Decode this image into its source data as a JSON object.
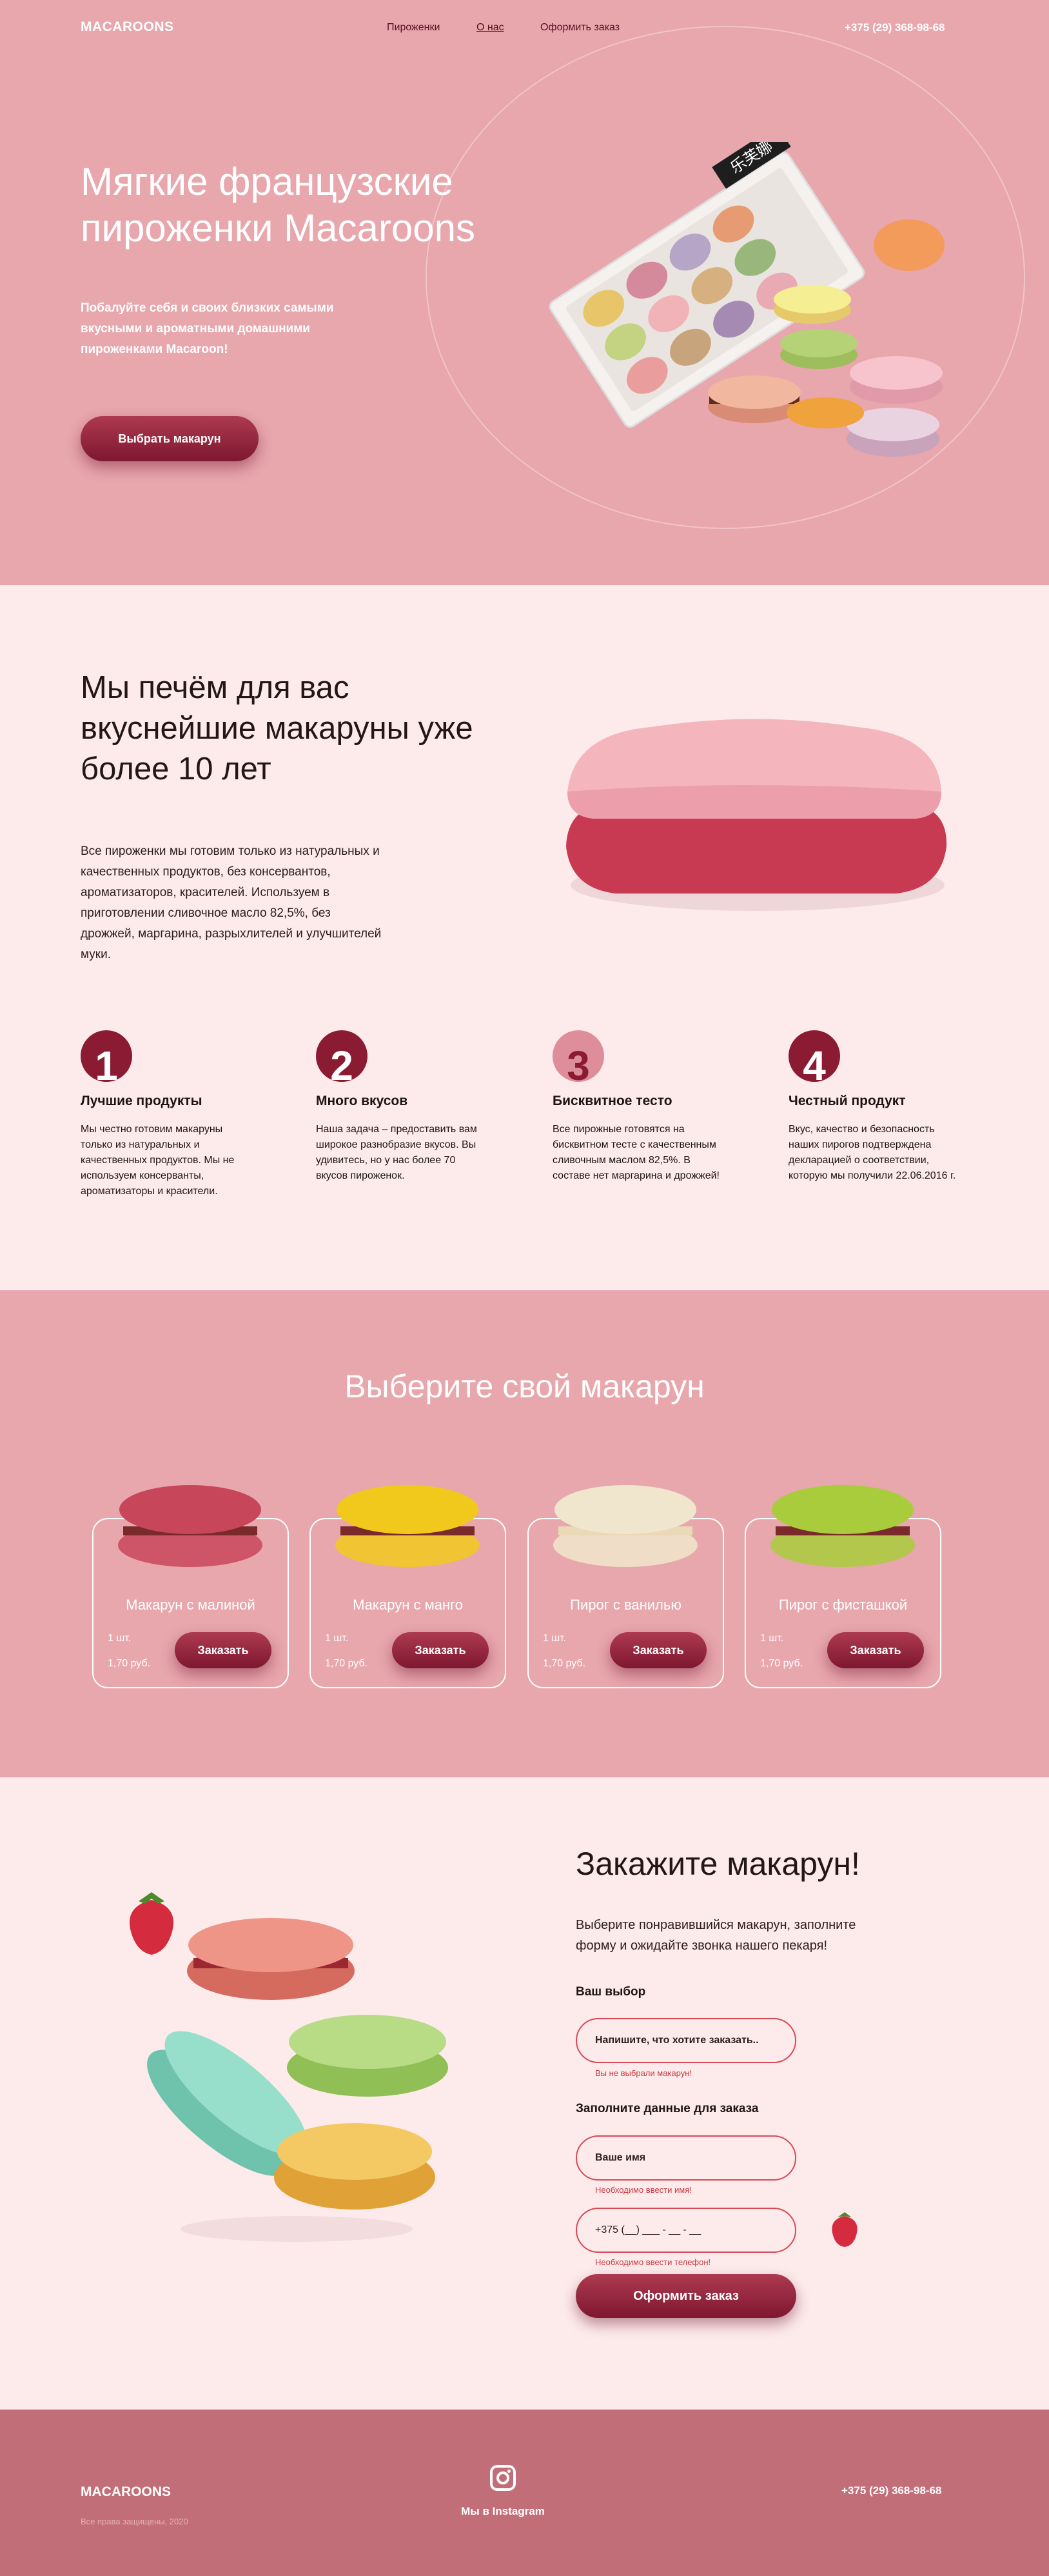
{
  "header": {
    "logo": "MACAROONS",
    "nav": [
      "Пироженки",
      "О нас",
      "Оформить заказ"
    ],
    "phone": "+375 (29) 368-98-68"
  },
  "hero": {
    "title": "Мягкие французские пироженки Macaroons",
    "subtitle": "Побалуйте себя и своих близких самыми вкусными и ароматными домашними пироженками Macaroon!",
    "button": "Выбрать макарун",
    "box_label": "乐芙娜"
  },
  "about": {
    "title": "Мы печём для вас вкуснейшие макаруны уже более 10 лет",
    "text": "Все пироженки мы готовим только из натуральных и качественных продуктов, без консервантов, ароматизаторов, красителей. Используем в приготовлении сливочное масло 82,5%, без дрожжей, маргарина, разрыхлителей и улучшителей муки.",
    "features": [
      {
        "num": "1",
        "title": "Лучшие продукты",
        "text": "Мы честно готовим макаруны только из натуральных и качественных продуктов. Мы не используем консерванты, ароматизаторы и красители."
      },
      {
        "num": "2",
        "title": "Много вкусов",
        "text": "Наша задача – предоставить вам широкое разнобразие вкусов. Вы удивитесь, но у нас более 70 вкусов пироженок."
      },
      {
        "num": "3",
        "title": "Бисквитное тесто",
        "text": "Все пирожные готовятся на бисквитном тесте с качественным сливочным маслом 82,5%. В составе нет маргарина и дрожжей!"
      },
      {
        "num": "4",
        "title": "Честный продукт",
        "text": "Вкус, качество и безопасность наших пирогов подтверждена декларацией о соответствии, которую мы получили 22.06.2016 г."
      }
    ]
  },
  "catalog": {
    "title": "Выберите свой макарун",
    "items": [
      {
        "name": "Макарун с малиной",
        "qty": "1 шт.",
        "price": "1,70 руб.",
        "button": "Заказать",
        "color": "#c8465a"
      },
      {
        "name": "Макарун с манго",
        "qty": "1 шт.",
        "price": "1,70 руб.",
        "button": "Заказать",
        "color": "#f1c91c"
      },
      {
        "name": "Пирог с ванилью",
        "qty": "1 шт.",
        "price": "1,70 руб.",
        "button": "Заказать",
        "color": "#f0e6cd"
      },
      {
        "name": "Пирог с фисташкой",
        "qty": "1 шт.",
        "price": "1,70 руб.",
        "button": "Заказать",
        "color": "#a9cc3c"
      }
    ]
  },
  "order": {
    "title": "Закажите макарун!",
    "subtitle": "Выберите понравившийся макарун, заполните форму и ожидайте звонка нашего пекаря!",
    "choice_label": "Ваш выбор",
    "choice_placeholder": "Напишите, что хотите заказать..",
    "choice_error": "Вы не выбрали макарун!",
    "data_label": "Заполните данные для заказа",
    "name_placeholder": "Ваше имя",
    "name_error": "Необходимо ввести имя!",
    "phone_value": "+375 (__) ___ - __ - __",
    "phone_error": "Необходимо ввести телефон!",
    "button": "Оформить заказ"
  },
  "footer": {
    "logo": "MACAROONS",
    "copyright": "Все права защищены, 2020",
    "instagram": "Мы в Instagram",
    "phone": "+375 (29) 368-98-68"
  },
  "colors": {
    "hero_bg": "#e8a6ad",
    "light_bg": "#fdebec",
    "accent": "#8b1a33",
    "footer_bg": "#c26e79",
    "error": "#c9343f"
  }
}
